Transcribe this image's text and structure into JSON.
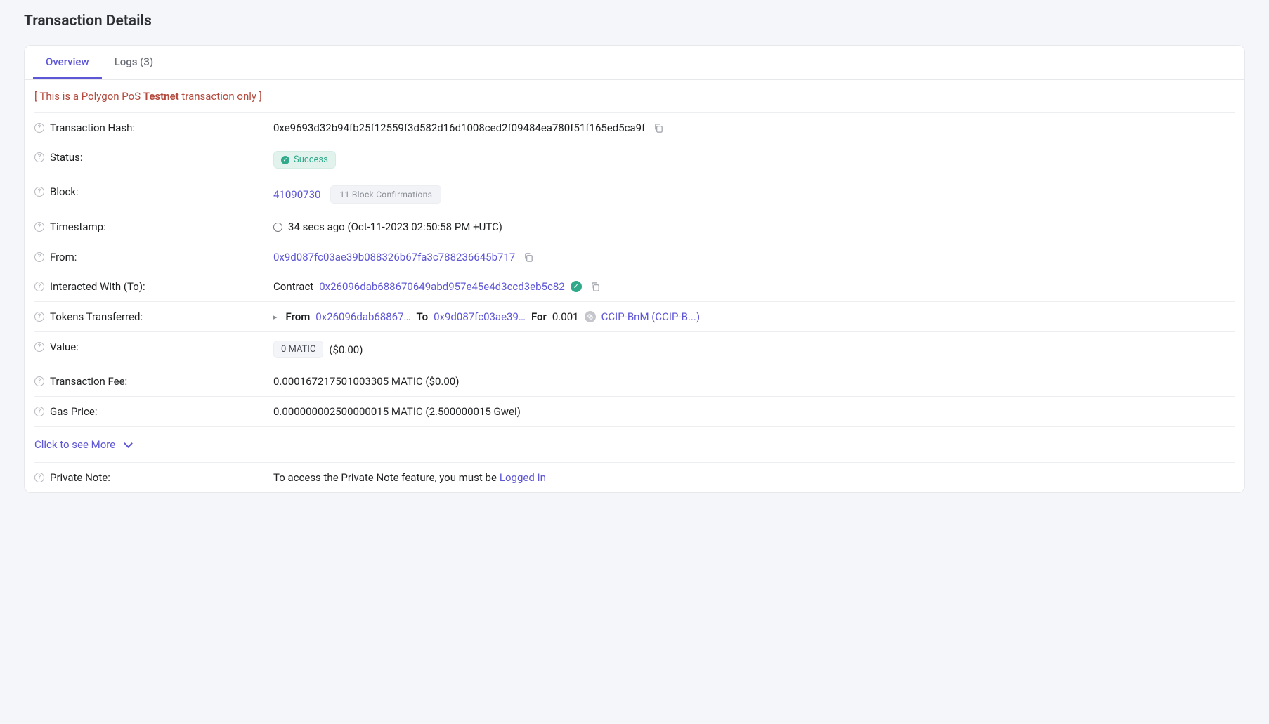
{
  "page": {
    "title": "Transaction Details"
  },
  "tabs": {
    "overview": "Overview",
    "logs": "Logs (3)"
  },
  "notice": {
    "prefix": "[ This is a Polygon PoS ",
    "bold": "Testnet",
    "suffix": " transaction only ]"
  },
  "labels": {
    "hash": "Transaction Hash:",
    "status": "Status:",
    "block": "Block:",
    "timestamp": "Timestamp:",
    "from": "From:",
    "to": "Interacted With (To):",
    "tokens": "Tokens Transferred:",
    "value": "Value:",
    "fee": "Transaction Fee:",
    "gas": "Gas Price:",
    "private_note": "Private Note:"
  },
  "tx": {
    "hash": "0xe9693d32b94fb25f12559f3d582d16d1008ced2f09484ea780f51f165ed5ca9f",
    "status": "Success",
    "block": "41090730",
    "confirmations": "11 Block Confirmations",
    "timestamp": "34 secs ago (Oct-11-2023 02:50:58 PM +UTC)",
    "from": "0x9d087fc03ae39b088326b67fa3c788236645b717",
    "to_prefix": "Contract",
    "to": "0x26096dab688670649abd957e45e4d3ccd3eb5c82",
    "transfer": {
      "from_label": "From",
      "from_addr": "0x26096dab68867…",
      "to_label": "To",
      "to_addr": "0x9d087fc03ae39…",
      "for_label": "For",
      "amount": "0.001",
      "token": "CCIP-BnM (CCIP-B...)"
    },
    "value_badge": "0 MATIC",
    "value_usd": "($0.00)",
    "fee": "0.000167217501003305 MATIC ($0.00)",
    "gas": "0.000000002500000015 MATIC (2.500000015 Gwei)"
  },
  "see_more": "Click to see More",
  "private_note": {
    "text": "To access the Private Note feature, you must be ",
    "link": "Logged In"
  }
}
